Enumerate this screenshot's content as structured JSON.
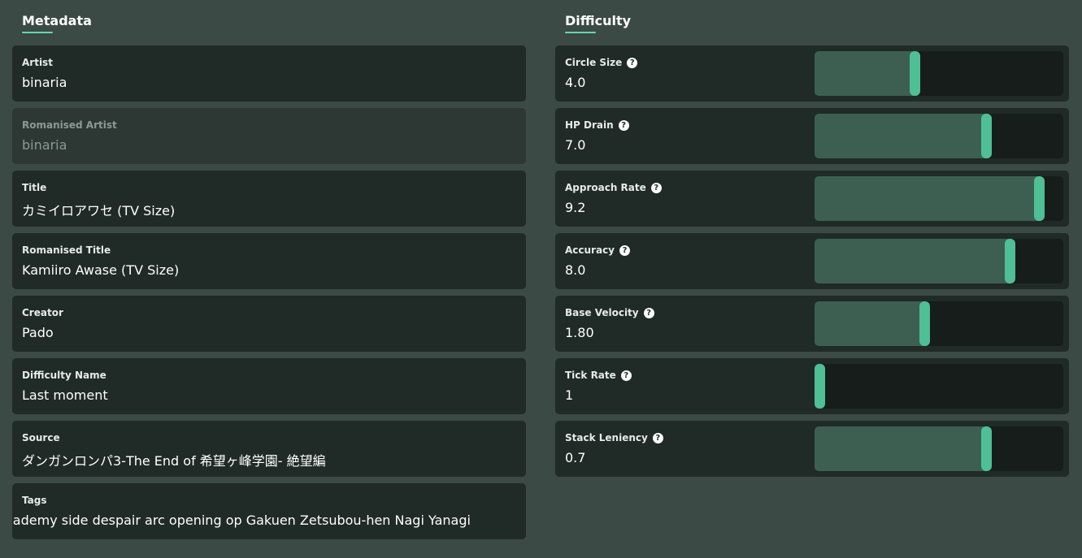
{
  "metadata": {
    "title": "Metadata",
    "fields": [
      {
        "label": "Artist",
        "value": "binaria"
      },
      {
        "label": "Romanised Artist",
        "value": "binaria"
      },
      {
        "label": "Title",
        "value": "カミイロアワセ (TV Size)"
      },
      {
        "label": "Romanised Title",
        "value": "Kamiiro Awase (TV Size)"
      },
      {
        "label": "Creator",
        "value": "Pado"
      },
      {
        "label": "Difficulty Name",
        "value": "Last moment"
      },
      {
        "label": "Source",
        "value": "ダンガンロンパ3-The End of 希望ヶ峰学園- 絶望編"
      },
      {
        "label": "Tags",
        "value": "cademy side despair arc opening op Gakuen Zetsubou-hen Nagi Yanagi"
      }
    ]
  },
  "difficulty": {
    "title": "Difficulty",
    "help_glyph": "?",
    "settings": [
      {
        "label": "Circle Size",
        "value": "4.0",
        "fraction": 0.4
      },
      {
        "label": "HP Drain",
        "value": "7.0",
        "fraction": 0.7
      },
      {
        "label": "Approach Rate",
        "value": "9.2",
        "fraction": 0.92
      },
      {
        "label": "Accuracy",
        "value": "8.0",
        "fraction": 0.8
      },
      {
        "label": "Base Velocity",
        "value": "1.80",
        "fraction": 0.44
      },
      {
        "label": "Tick Rate",
        "value": "1",
        "fraction": 0.0
      },
      {
        "label": "Stack Leniency",
        "value": "0.7",
        "fraction": 0.7
      }
    ]
  },
  "colors": {
    "background": "#3b4a45",
    "field": "#202a27",
    "accent": "#66d9b0",
    "slider_fill": "#3c5f52",
    "slider_knob": "#4fbf95"
  }
}
